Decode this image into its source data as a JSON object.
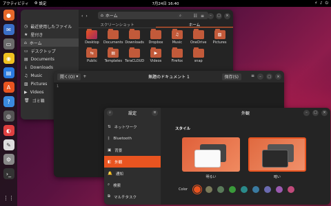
{
  "topbar": {
    "activities": "アクティビティ",
    "app_name": "設定",
    "clock": "7月24日 16:40"
  },
  "dock": {
    "icons": [
      "firefox-icon",
      "thunderbird-icon",
      "files-icon",
      "rhythmbox-icon",
      "writer-icon",
      "software-icon",
      "help-icon",
      "disc-icon",
      "chrome-icon",
      "text-editor-icon",
      "settings-icon",
      "terminal-icon"
    ]
  },
  "files": {
    "path": "ホーム",
    "sidebar": [
      "最近使用したファイル",
      "星付き",
      "ホーム",
      "デスクトップ",
      "Documents",
      "Downloads",
      "Music",
      "Pictures",
      "Videos",
      "ゴミ箱"
    ],
    "tabs": [
      "スクリーンショット",
      "ホーム"
    ],
    "items": [
      "Desktop",
      "Documents",
      "Downloads",
      "Dropbox",
      "Music",
      "OneDrive",
      "Pictures",
      "Public",
      "Templates",
      "TeraCLOUD",
      "Videos",
      "Firefox",
      "snap"
    ]
  },
  "editor": {
    "open_label": "開く(O)",
    "title": "無題のドキュメント 1",
    "save_label": "保存(S)",
    "line_number": "1"
  },
  "settings": {
    "sidebar_title": "設定",
    "main_title": "外観",
    "sidebar_items": [
      "ネットワーク",
      "Bluetooth",
      "背景",
      "外観",
      "通知",
      "検索",
      "マルチタスク"
    ],
    "section_title": "スタイル",
    "theme_light": "明るい",
    "theme_dark": "暗い",
    "color_label": "Color",
    "accent_colors": [
      "#e95420",
      "#7a7a5a",
      "#5a7a5a",
      "#3a9a3a",
      "#2a8a8a",
      "#3a7aa0",
      "#6a6ab0",
      "#9a5ab0",
      "#c04a7a"
    ]
  }
}
